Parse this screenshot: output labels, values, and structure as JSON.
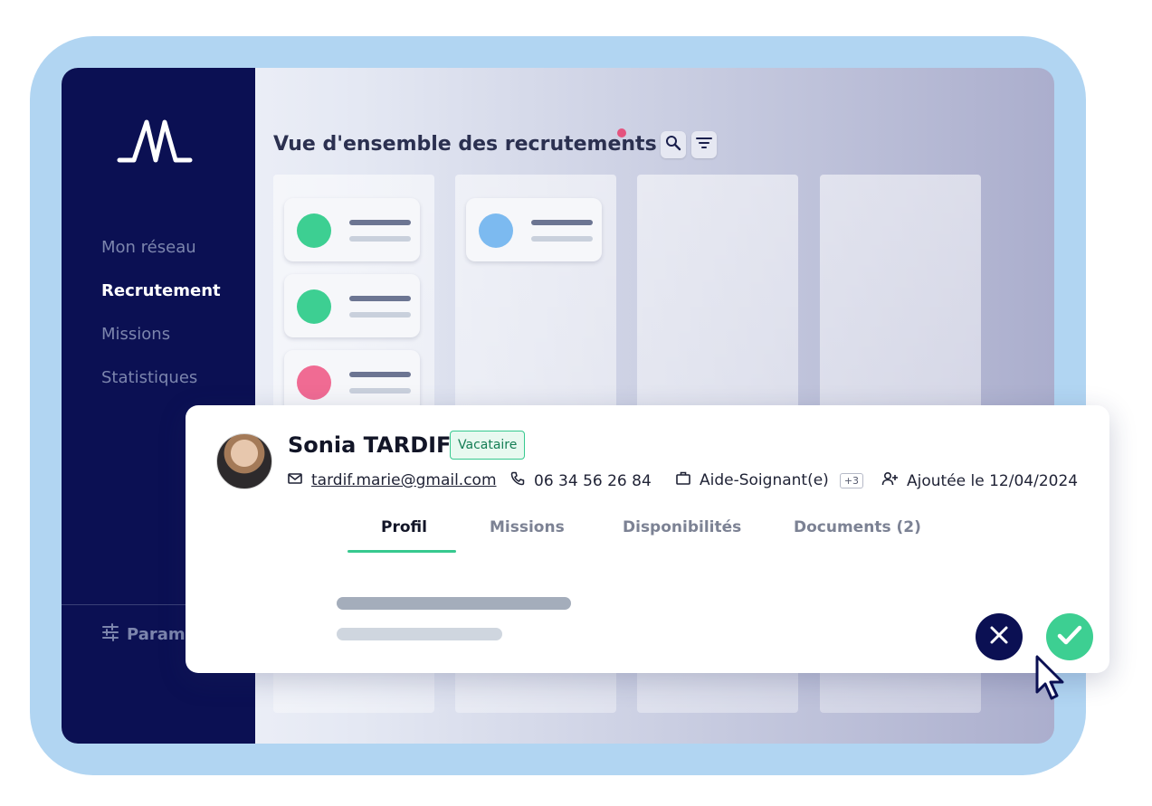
{
  "sidebar": {
    "logo_icon": "pulse-logo-icon",
    "items": [
      {
        "label": "Mon réseau",
        "active": false
      },
      {
        "label": "Recrutement",
        "active": true
      },
      {
        "label": "Missions",
        "active": false
      },
      {
        "label": "Statistiques",
        "active": false
      }
    ],
    "settings_label": "Paramè",
    "settings_icon": "sliders-icon"
  },
  "header": {
    "title": "Vue d'ensemble des recrutements",
    "search_icon": "search-icon",
    "filter_icon": "filter-icon"
  },
  "board": {
    "card_colors": [
      "#3dcf92",
      "#3dcf92",
      "#f06b93",
      "#7cbaf0"
    ]
  },
  "profile": {
    "name": "Sonia TARDIF",
    "badge": "Vacataire",
    "email": "tardif.marie@gmail.com",
    "phone": "06 34 56 26 84",
    "role": "Aide-Soignant(e)",
    "role_extra": "+3",
    "added": "Ajoutée le 12/04/2024",
    "tabs": [
      {
        "label": "Profil",
        "active": true
      },
      {
        "label": "Missions",
        "active": false
      },
      {
        "label": "Disponibilités",
        "active": false
      },
      {
        "label": "Documents (2)",
        "active": false
      }
    ]
  },
  "actions": {
    "reject_icon": "close-icon",
    "accept_icon": "check-icon"
  },
  "colors": {
    "sidebar_bg": "#0b1053",
    "accent_green": "#3dcf92",
    "frame_blue": "#b1d5f2",
    "notification": "#e4537e"
  }
}
